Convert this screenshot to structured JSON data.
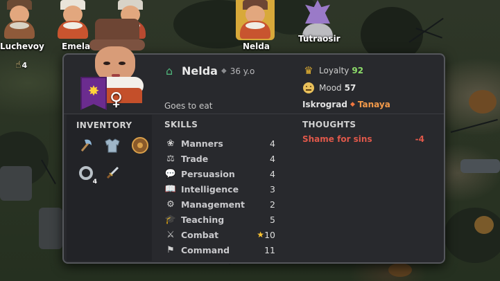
{
  "characters": [
    {
      "name": "Luchevoy",
      "selected": false
    },
    {
      "name": "Emela",
      "selected": false
    },
    {
      "name": "",
      "selected": false
    },
    {
      "name": "Nelda",
      "selected": true
    },
    {
      "name": "Tutraosir",
      "selected": false
    }
  ],
  "notification_count": "4",
  "character": {
    "name": "Nelda",
    "age": "36 y.o",
    "activity": "Goes to eat",
    "gender_symbol": "♀",
    "loyalty_label": "Loyalty",
    "loyalty_value": "92",
    "mood_label": "Mood",
    "mood_value": "57",
    "settlement": "Iskrograd",
    "ruler": "Tanaya"
  },
  "inventory": {
    "title": "INVENTORY",
    "items": [
      {
        "icon": "axe-icon",
        "count": ""
      },
      {
        "icon": "armor-icon",
        "count": ""
      },
      {
        "icon": "shield-icon",
        "count": ""
      },
      {
        "icon": "ring-icon",
        "count": "4"
      },
      {
        "icon": "dagger-icon",
        "count": ""
      }
    ]
  },
  "skills": {
    "title": "SKILLS",
    "items": [
      {
        "icon": "manners-icon",
        "name": "Manners",
        "value": "4",
        "starred": false
      },
      {
        "icon": "scales-icon",
        "name": "Trade",
        "value": "4",
        "starred": false
      },
      {
        "icon": "speech-icon",
        "name": "Persuasion",
        "value": "4",
        "starred": false
      },
      {
        "icon": "book-icon",
        "name": "Intelligence",
        "value": "3",
        "starred": false
      },
      {
        "icon": "gear-icon",
        "name": "Management",
        "value": "2",
        "starred": false
      },
      {
        "icon": "graduation-cap-icon",
        "name": "Teaching",
        "value": "5",
        "starred": false
      },
      {
        "icon": "crossed-swords-icon",
        "name": "Combat",
        "value": "10",
        "starred": true
      },
      {
        "icon": "flag-icon",
        "name": "Command",
        "value": "11",
        "starred": false
      }
    ]
  },
  "thoughts": {
    "title": "THOUGHTS",
    "items": [
      {
        "text": "Shame for sins",
        "value": "-4"
      }
    ]
  },
  "colors": {
    "panel_bg": "#28292d",
    "loyalty_value": "#8ddc6a",
    "thought_negative": "#e0584a",
    "ruler": "#f39a4a",
    "selected_portrait": "#d8a93a",
    "house_banner": "#6b2c8f"
  }
}
